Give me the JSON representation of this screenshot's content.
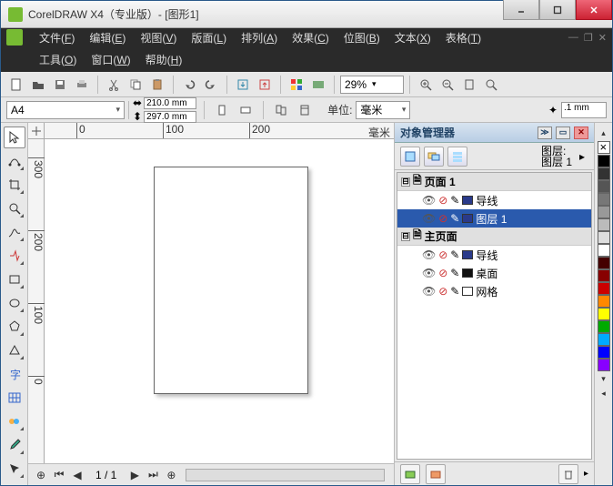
{
  "title": "CorelDRAW X4（专业版）- [图形1]",
  "menus": {
    "row1": [
      {
        "label": "文件",
        "key": "F"
      },
      {
        "label": "编辑",
        "key": "E"
      },
      {
        "label": "视图",
        "key": "V"
      },
      {
        "label": "版面",
        "key": "L"
      },
      {
        "label": "排列",
        "key": "A"
      },
      {
        "label": "效果",
        "key": "C"
      },
      {
        "label": "位图",
        "key": "B"
      },
      {
        "label": "文本",
        "key": "X"
      },
      {
        "label": "表格",
        "key": "T"
      }
    ],
    "row2": [
      {
        "label": "工具",
        "key": "O"
      },
      {
        "label": "窗口",
        "key": "W"
      },
      {
        "label": "帮助",
        "key": "H"
      }
    ]
  },
  "toolbar": {
    "zoom": "29%"
  },
  "property_bar": {
    "paper": "A4",
    "width": "210.0 mm",
    "height": "297.0 mm",
    "unit_label": "单位:",
    "unit_value": "毫米",
    "nudge": ".1 mm"
  },
  "ruler": {
    "h": [
      "0",
      "100",
      "200"
    ],
    "h_end": "毫米",
    "v": [
      "300",
      "200",
      "100",
      "0"
    ]
  },
  "status": {
    "page_current": "1",
    "page_total": "1",
    "page_label": "1 / 1"
  },
  "panel": {
    "title": "对象管理器",
    "layer_label": "图层:",
    "layer_name": "图层 1",
    "tree": [
      {
        "type": "page",
        "label": "页面 1",
        "expand": "⊟"
      },
      {
        "type": "layer",
        "label": "导线",
        "color": "#2a3a8a",
        "indent": 1
      },
      {
        "type": "layer",
        "label": "图层 1",
        "color": "#2a3a8a",
        "indent": 1,
        "selected": true
      },
      {
        "type": "page",
        "label": "主页面",
        "expand": "⊟"
      },
      {
        "type": "layer",
        "label": "导线",
        "color": "#2a3a8a",
        "indent": 1
      },
      {
        "type": "layer",
        "label": "桌面",
        "color": "#111",
        "indent": 1
      },
      {
        "type": "layer",
        "label": "网格",
        "color": "#fff",
        "indent": 1
      }
    ]
  },
  "palette": [
    "#000",
    "#333",
    "#555",
    "#777",
    "#999",
    "#bbb",
    "#ddd",
    "#fff",
    "#400",
    "#800",
    "#c00",
    "#f80",
    "#ff0",
    "#0a0",
    "#0af",
    "#00f",
    "#80f"
  ]
}
